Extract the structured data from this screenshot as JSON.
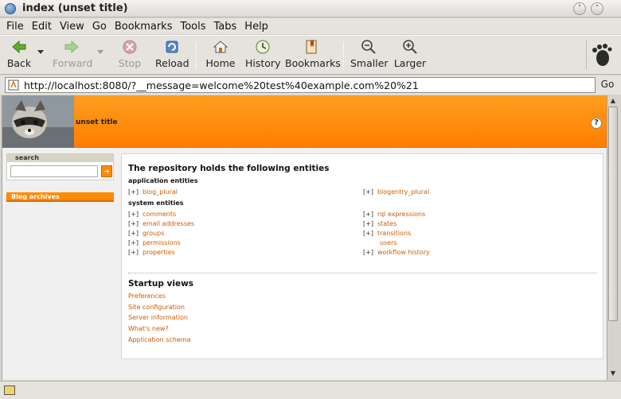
{
  "window": {
    "title": "index (unset title)"
  },
  "menu": [
    "File",
    "Edit",
    "View",
    "Go",
    "Bookmarks",
    "Tools",
    "Tabs",
    "Help"
  ],
  "toolbar": {
    "back": "Back",
    "forward": "Forward",
    "stop": "Stop",
    "reload": "Reload",
    "home": "Home",
    "history": "History",
    "bookmarks": "Bookmarks",
    "smaller": "Smaller",
    "larger": "Larger"
  },
  "address": {
    "url": "http://localhost:8080/?__message=welcome%20test%40example.com%20%21",
    "go": "Go"
  },
  "page": {
    "title": "unset title",
    "help": "?",
    "search_heading": "search",
    "archives": "Blog archives",
    "heading": "The repository holds the following entities",
    "app_entities_heading": "application entities",
    "app_entities": [
      "blog_plural",
      "blogentry_plural"
    ],
    "sys_entities_heading": "system entities",
    "sys_left": [
      "comments",
      "email addresses",
      "groups",
      "permissions",
      "properties"
    ],
    "sys_right": [
      "rql expressions",
      "states",
      "transitions",
      "users",
      "workflow history"
    ],
    "expand": "[+]",
    "startup_heading": "Startup views",
    "startup_views": [
      "Preferences",
      "Site configuration",
      "Server information",
      "What's new?",
      "Application schema"
    ]
  },
  "colors": {
    "accent": "#ff8a00",
    "link": "#d05a00"
  }
}
